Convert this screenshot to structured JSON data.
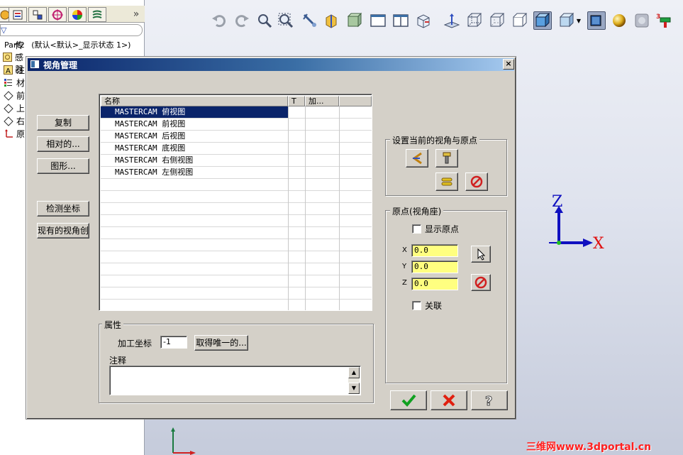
{
  "tree": {
    "part_name": "Part2",
    "config_text": "(默认<默认>_显示状态 1>)",
    "items": [
      {
        "label": "传感器",
        "icon": "sensor-icon"
      },
      {
        "label": "注",
        "icon": "annotation-icon"
      },
      {
        "label": "材",
        "icon": "material-icon"
      },
      {
        "label": "前",
        "icon": "plane-icon"
      },
      {
        "label": "上",
        "icon": "plane-icon"
      },
      {
        "label": "右",
        "icon": "plane-icon"
      },
      {
        "label": "原",
        "icon": "origin-icon"
      }
    ],
    "tab_expand": "»"
  },
  "dialog": {
    "title": "视角管理",
    "close_label": "×",
    "left_buttons": {
      "copy": "复制",
      "relative": "相对的...",
      "graphic": "图形...",
      "detect": "检测坐标",
      "existing": "现有的视角创"
    },
    "list": {
      "headers": [
        "名称",
        "T",
        "加..."
      ],
      "rows": [
        "MASTERCAM 俯视图",
        "MASTERCAM 前视图",
        "MASTERCAM 后视图",
        "MASTERCAM 底视图",
        "MASTERCAM 右侧视图",
        "MASTERCAM 左侧视图"
      ],
      "selected_index": 0
    },
    "set_current": {
      "title": "设置当前的视角与原点"
    },
    "origin": {
      "title": "原点(视角座)",
      "show_origin_label": "显示原点",
      "x_label": "X",
      "x_value": "0.0",
      "y_label": "Y",
      "y_value": "0.0",
      "z_label": "Z",
      "z_value": "0.0",
      "associate_label": "关联"
    },
    "properties": {
      "title": "属性",
      "work_coord_label": "加工坐标",
      "work_coord_value": "-1",
      "get_unique_label": "取得唯一的...",
      "notes_label": "注释"
    }
  },
  "axis": {
    "x_label": "X",
    "z_label": "Z"
  },
  "watermark": "三维网www.3dportal.cn",
  "colors": {
    "title_bar": "#0a246a",
    "dialog_bg": "#d4d0c8",
    "input_highlight": "#ffff80",
    "selection": "#0a246a",
    "axis_x": "#e01010",
    "axis_z": "#1010c0",
    "watermark": "#ff2020"
  }
}
